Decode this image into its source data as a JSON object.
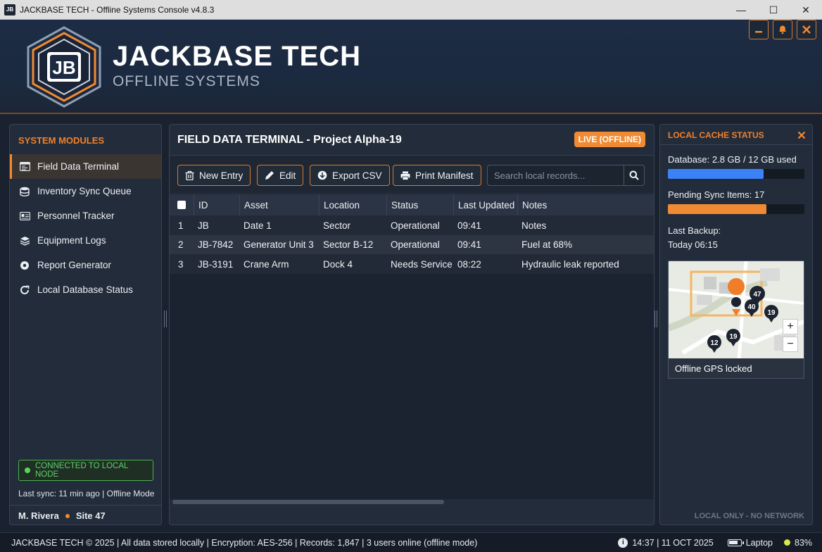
{
  "window": {
    "title": "JACKBASE TECH - Offline Systems Console v4.8.3",
    "icon_text": "JB",
    "minimize": "—",
    "maximize": "☐",
    "close": "✕"
  },
  "header": {
    "logo_text": "JB",
    "brand": "JACKBASE TECH",
    "subtitle": "OFFLINE SYSTEMS",
    "buttons": [
      "minimize-icon",
      "bell-icon",
      "close-icon"
    ],
    "accent": "#f08a33"
  },
  "sidebar": {
    "title": "SYSTEM MODULES",
    "items": [
      {
        "label": "Field Data Terminal",
        "icon": "terminal-icon",
        "active": true
      },
      {
        "label": "Inventory Sync Queue",
        "icon": "database-icon"
      },
      {
        "label": "Personnel Tracker",
        "icon": "id-card-icon"
      },
      {
        "label": "Equipment Logs",
        "icon": "layers-icon"
      },
      {
        "label": "Report Generator",
        "icon": "settings-icon"
      },
      {
        "label": "Local Database Status",
        "icon": "refresh-icon"
      }
    ],
    "connection": "CONNECTED TO LOCAL NODE",
    "last_sync": "Last sync: 11 min ago | Offline Mode",
    "user": "M. Rivera",
    "site": "Site 47"
  },
  "main": {
    "title": "FIELD DATA TERMINAL - Project Alpha-19",
    "badge": "LIVE (OFFLINE)",
    "toolbar": {
      "new_entry": "New Entry",
      "edit": "Edit",
      "export": "Export CSV",
      "print": "Print Manifest"
    },
    "search": {
      "placeholder": "Search local records..."
    },
    "columns": [
      "ID",
      "Asset",
      "Location",
      "Status",
      "Last Updated",
      "Notes"
    ],
    "rows": [
      {
        "n": "1",
        "id": "JB",
        "asset": "Date 1",
        "location": "Sector",
        "status": "Operational",
        "updated": "09:41",
        "notes": "Notes"
      },
      {
        "n": "2",
        "id": "JB-7842",
        "asset": "Generator Unit 3",
        "location": "Sector B-12",
        "status": "Operational",
        "updated": "09:41",
        "notes": "Fuel at 68%"
      },
      {
        "n": "3",
        "id": "JB-3191",
        "asset": "Crane Arm",
        "location": "Dock 4",
        "status": "Needs Service",
        "updated": "08:22",
        "notes": "Hydraulic leak reported"
      }
    ]
  },
  "cache": {
    "title": "LOCAL CACHE STATUS",
    "database_label": "Database: 2.8 GB / 12 GB used",
    "database_fill": 0.7,
    "database_color": "#3b82f6",
    "pending_label": "Pending Sync Items: 17",
    "pending_fill": 0.72,
    "pending_color": "#f08a33",
    "backup_label": "Last Backup:",
    "backup_value": "Today 06:15",
    "map_caption": "Offline GPS locked",
    "map_pins": [
      "47",
      "40",
      "19",
      "12",
      "19"
    ],
    "zoom_in": "+",
    "zoom_out": "−",
    "footer": "LOCAL ONLY - NO NETWORK"
  },
  "status": {
    "left": "JACKBASE TECH © 2025 | All data stored locally | Encryption: AES-256 | Records: 1,847 | 3 users online (offline mode)",
    "datetime": "14:37 | 11 OCT 2025",
    "device": "Laptop",
    "battery": "83%",
    "battery_level": 0.83
  }
}
